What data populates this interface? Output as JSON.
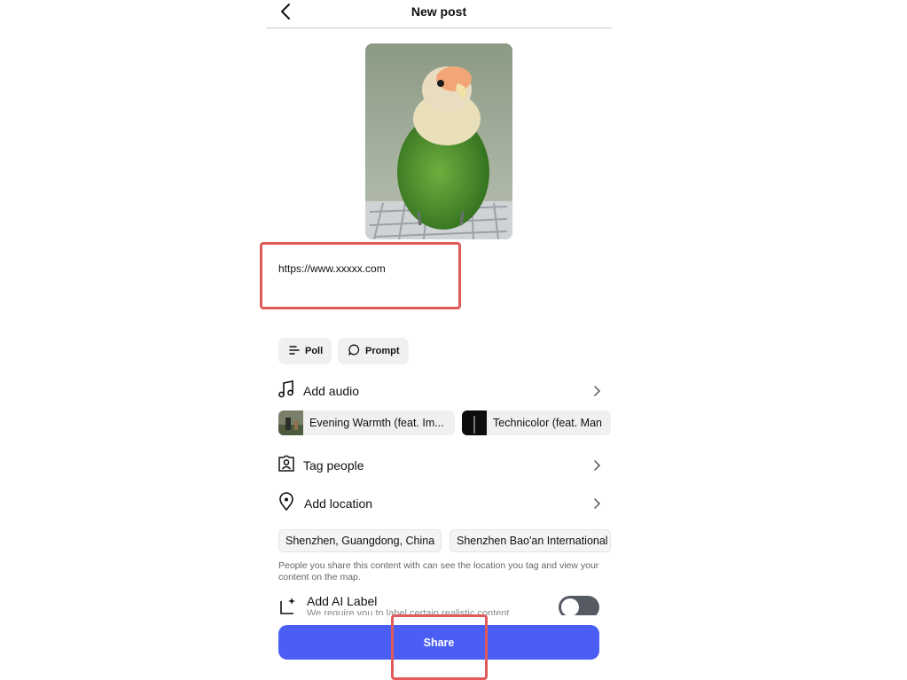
{
  "header": {
    "title": "New post"
  },
  "post": {
    "caption": "https://www.xxxxx.com"
  },
  "options": [
    {
      "label": "Poll",
      "icon": "poll-icon"
    },
    {
      "label": "Prompt",
      "icon": "prompt-icon"
    }
  ],
  "audio": {
    "label": "Add audio",
    "tracks": [
      {
        "title": "Evening Warmth (feat. Im..."
      },
      {
        "title": "Technicolor (feat. Man"
      }
    ]
  },
  "tag_people": {
    "label": "Tag people"
  },
  "location": {
    "label": "Add location",
    "suggestions": [
      "Shenzhen, Guangdong, China",
      "Shenzhen Bao'an International"
    ],
    "note": "People you share this content with can see the location you tag and view your content on the map."
  },
  "ai_label": {
    "label": "Add AI Label",
    "subtext": "We require you to label certain realistic content",
    "enabled": false
  },
  "share": {
    "label": "Share"
  },
  "colors": {
    "accent": "#4a5ef4",
    "highlight": "#e05a5a",
    "toggle_off": "#565a63"
  }
}
